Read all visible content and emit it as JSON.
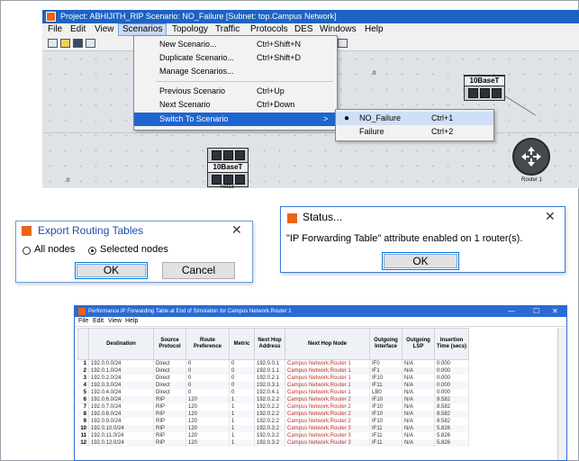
{
  "app": {
    "title": "Project: ABHIJITH_RIP Scenario: NO_Failure [Subnet: top.Campus Network]",
    "menu": [
      "File",
      "Edit",
      "View",
      "Scenarios",
      "Topology",
      "Traffic",
      "Protocols",
      "DES",
      "Windows",
      "Help"
    ],
    "active_menu": "Scenarios",
    "scenarios_menu": [
      {
        "label": "New Scenario...",
        "shortcut": "Ctrl+Shift+N"
      },
      {
        "label": "Duplicate Scenario...",
        "shortcut": "Ctrl+Shift+D"
      },
      {
        "label": "Manage Scenarios...",
        "shortcut": ""
      },
      {
        "label": "Previous Scenario",
        "shortcut": "Ctrl+Up"
      },
      {
        "label": "Next Scenario",
        "shortcut": "Ctrl+Down"
      },
      {
        "label": "Switch To Scenario",
        "shortcut": ">"
      }
    ],
    "switch_submenu": [
      {
        "label": "NO_Failure",
        "shortcut": "Ctrl+1",
        "checked": true
      },
      {
        "label": "Failure",
        "shortcut": "Ctrl+2",
        "checked": false
      }
    ],
    "nodes": {
      "subnet_a": "10BaseT",
      "subnet_b": "10BaseT",
      "subnet_b_name": "net13",
      "router": "Router 1"
    },
    "ruler_marks": {
      "left": "0",
      "middle": "0"
    }
  },
  "export_dialog": {
    "title": "Export Routing Tables",
    "option_all": "All nodes",
    "option_selected": "Selected nodes",
    "selected": "Selected nodes",
    "ok": "OK",
    "cancel": "Cancel"
  },
  "status_dialog": {
    "title": "Status...",
    "message": "\"IP Forwarding Table\" attribute enabled on 1 router(s).",
    "ok": "OK"
  },
  "table_window": {
    "title": "Performance.IP Forwarding Table at End of Simulation for Campus Network.Router 1",
    "menu": [
      "File",
      "Edit",
      "View",
      "Help"
    ],
    "columns": [
      "",
      "Destination",
      "Source Protocol",
      "Route Preference",
      "Metric",
      "Next Hop Address",
      "Next Hop Node",
      "Outgoing Interface",
      "Outgoing LSP",
      "Insertion Time (secs)"
    ],
    "rows": [
      [
        "1",
        "192.0.0.0/24",
        "Direct",
        "0",
        "0",
        "192.0.0.1",
        "Campus Network.Router 1",
        "IF0",
        "N/A",
        "0.000"
      ],
      [
        "2",
        "192.0.1.0/24",
        "Direct",
        "0",
        "0",
        "192.0.1.1",
        "Campus Network.Router 1",
        "IF1",
        "N/A",
        "0.000"
      ],
      [
        "3",
        "192.0.2.0/24",
        "Direct",
        "0",
        "0",
        "192.0.2.1",
        "Campus Network.Router 1",
        "IF10",
        "N/A",
        "0.000"
      ],
      [
        "4",
        "192.0.3.0/24",
        "Direct",
        "0",
        "0",
        "192.0.3.1",
        "Campus Network.Router 1",
        "IF11",
        "N/A",
        "0.000"
      ],
      [
        "5",
        "192.0.4.0/24",
        "Direct",
        "0",
        "0",
        "192.0.4.1",
        "Campus Network.Router 1",
        "LB0",
        "N/A",
        "0.000"
      ],
      [
        "6",
        "192.0.6.0/24",
        "RIP",
        "120",
        "1",
        "192.0.2.2",
        "Campus Network.Router 2",
        "IF10",
        "N/A",
        "8.582"
      ],
      [
        "7",
        "192.0.7.0/24",
        "RIP",
        "120",
        "1",
        "192.0.2.2",
        "Campus Network.Router 2",
        "IF10",
        "N/A",
        "8.582"
      ],
      [
        "8",
        "192.0.8.0/24",
        "RIP",
        "120",
        "1",
        "192.0.2.2",
        "Campus Network.Router 2",
        "IF10",
        "N/A",
        "8.582"
      ],
      [
        "9",
        "192.0.9.0/24",
        "RIP",
        "120",
        "1",
        "192.0.2.2",
        "Campus Network.Router 2",
        "IF10",
        "N/A",
        "8.582"
      ],
      [
        "10",
        "192.0.10.0/24",
        "RIP",
        "120",
        "1",
        "192.0.3.2",
        "Campus Network.Router 3",
        "IF11",
        "N/A",
        "5.826"
      ],
      [
        "11",
        "192.0.11.0/24",
        "RIP",
        "120",
        "1",
        "192.0.3.2",
        "Campus Network.Router 3",
        "IF11",
        "N/A",
        "5.826"
      ],
      [
        "12",
        "192.0.12.0/24",
        "RIP",
        "120",
        "1",
        "192.0.3.2",
        "Campus Network.Router 3",
        "IF11",
        "N/A",
        "5.826"
      ]
    ]
  }
}
